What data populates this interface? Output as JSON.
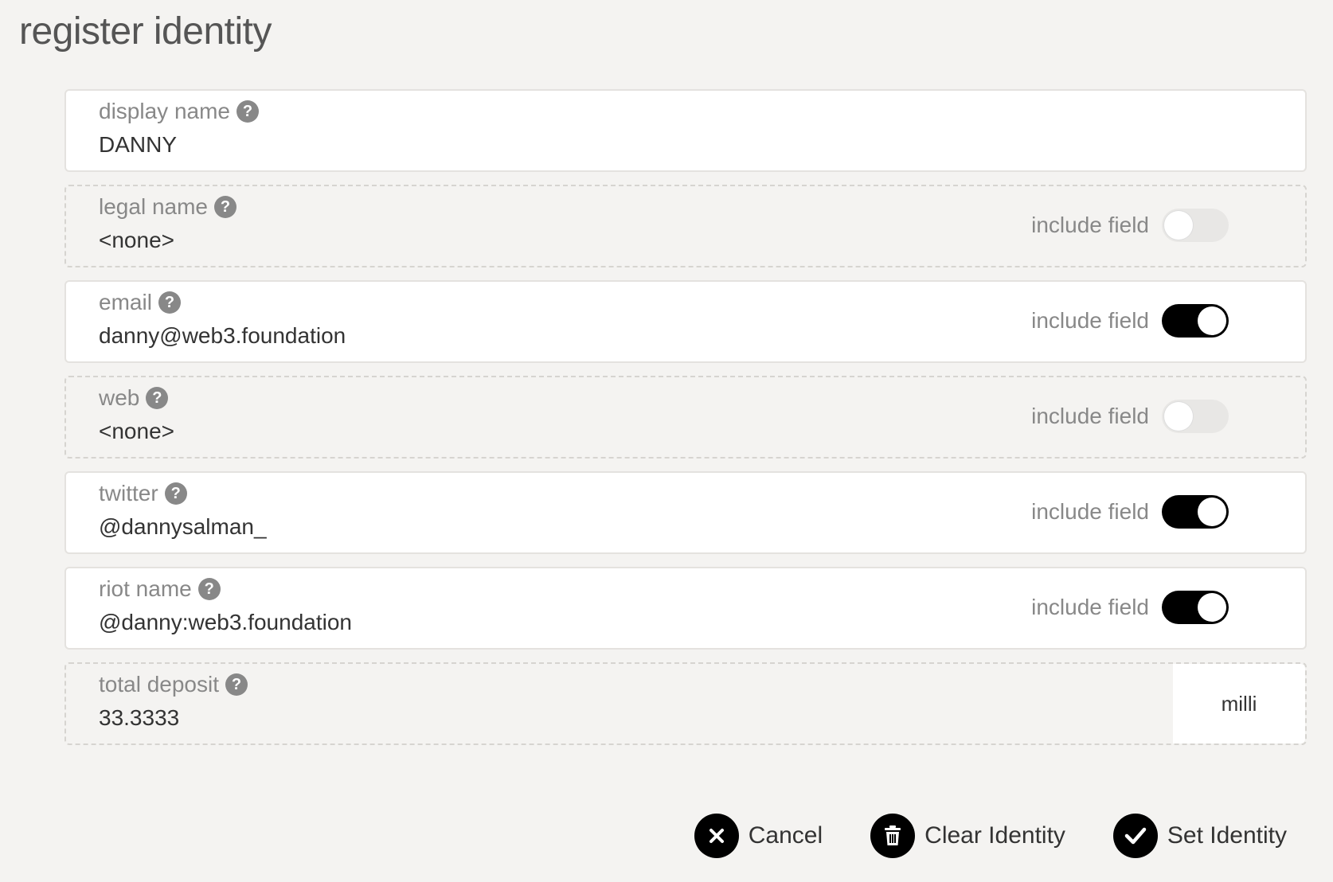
{
  "header": {
    "title": "register identity"
  },
  "include_label": "include field",
  "fields": [
    {
      "label": "display name",
      "value": "DANNY",
      "toggle": null,
      "included": true
    },
    {
      "label": "legal name",
      "value": "<none>",
      "toggle": false,
      "included": false
    },
    {
      "label": "email",
      "value": "danny@web3.foundation",
      "toggle": true,
      "included": true
    },
    {
      "label": "web",
      "value": "<none>",
      "toggle": false,
      "included": false
    },
    {
      "label": "twitter",
      "value": "@dannysalman_",
      "toggle": true,
      "included": true
    },
    {
      "label": "riot name",
      "value": "@danny:web3.foundation",
      "toggle": true,
      "included": true
    }
  ],
  "deposit": {
    "label": "total deposit",
    "value": "33.3333",
    "unit": "milli"
  },
  "actions": {
    "cancel_label": "Cancel",
    "clear_label": "Clear Identity",
    "set_label": "Set Identity"
  }
}
